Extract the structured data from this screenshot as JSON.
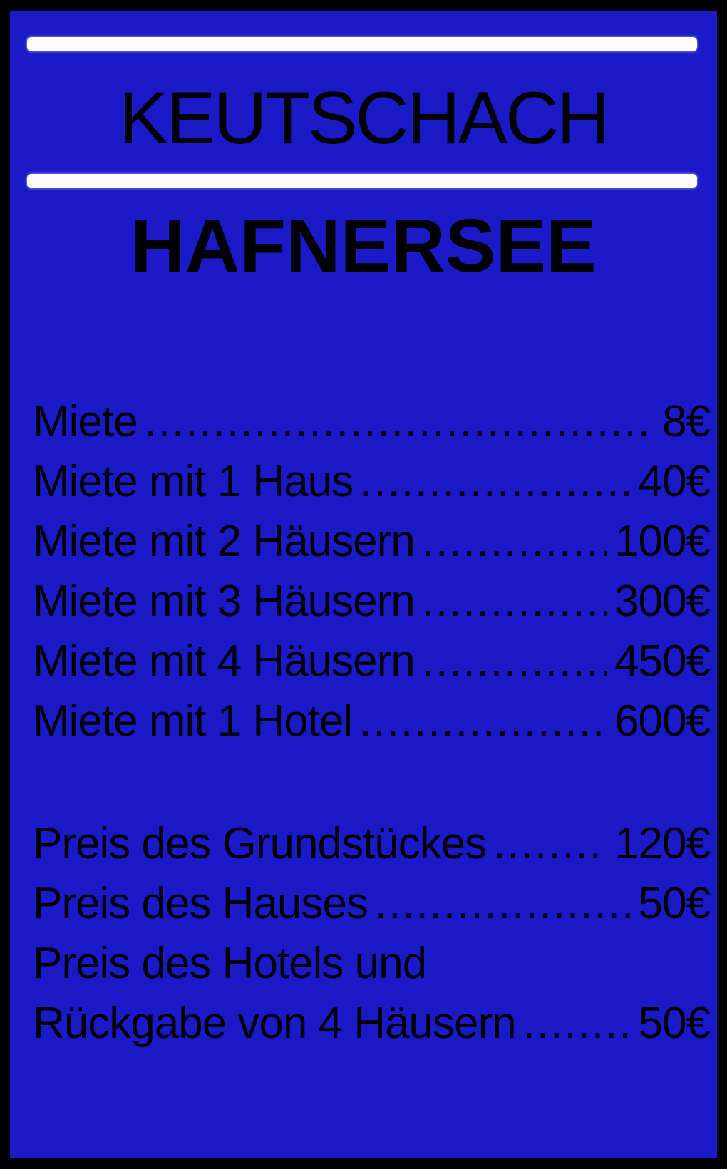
{
  "card": {
    "city": "KEUTSCHACH",
    "street": "HAFNERSEE",
    "background_color": "#1a1ac8",
    "stripe_color": "#ffffff"
  },
  "rent": [
    {
      "label": "Miete",
      "amount": "8€"
    },
    {
      "label": "Miete mit 1 Haus",
      "amount": "40€"
    },
    {
      "label": "Miete mit 2 Häusern",
      "amount": "100€"
    },
    {
      "label": "Miete mit 3 Häusern",
      "amount": "300€"
    },
    {
      "label": "Miete mit 4 Häusern",
      "amount": "450€"
    },
    {
      "label": "Miete mit 1 Hotel",
      "amount": "600€"
    }
  ],
  "prices": {
    "property_label": "Preis des Grundstückes",
    "property_amount": "120€",
    "house_label": "Preis des Hauses",
    "house_amount": "50€",
    "hotel_label_line1": "Preis des Hotels und",
    "hotel_label_line2": "Rückgabe von 4 Häusern",
    "hotel_amount": "50€"
  }
}
